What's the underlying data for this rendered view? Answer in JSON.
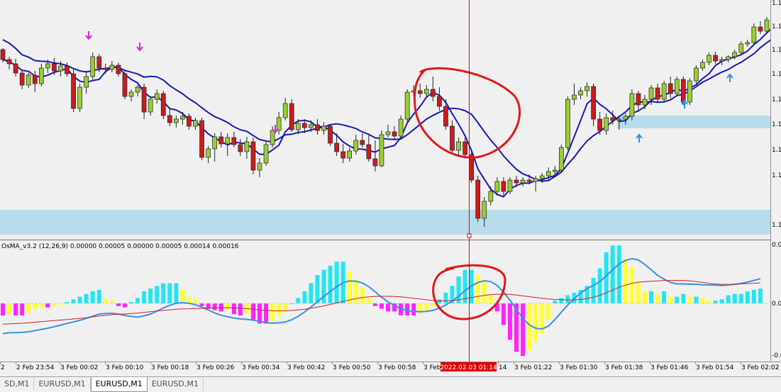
{
  "indicator_label": "OsMA_v3.2 (12,26,9) 0.00000 0.00005 0.00000 0.00005 0.00014 0.00016",
  "cursor_time_label": "2022.02.03 01:14",
  "price_tick_labels": [
    "1.1",
    "1.1",
    "1.1",
    "1.1",
    "1.1",
    "1.1",
    "1.1",
    "1.1",
    "1.1"
  ],
  "osc_tick_labels": [
    "0.0",
    "0.0",
    "-0.0"
  ],
  "time_labels": [
    "2",
    "2 Feb 23:54",
    "3 Feb 00:02",
    "3 Feb 00:10",
    "3 Feb 00:18",
    "3 Feb 00:26",
    "3 Feb 00:34",
    "3 Feb 00:42",
    "3 Feb 00:50",
    "3 Feb 00:58",
    "3 Feb",
    "14",
    "3 Feb 01:22",
    "3 Feb 01:30",
    "3 Feb 01:38",
    "3 Feb 01:46",
    "3 Feb 01:54",
    "3 Feb 02:02"
  ],
  "tabs": [
    {
      "label": "SD,M1",
      "active": false
    },
    {
      "label": "EURUSD,M1",
      "active": false
    },
    {
      "label": "EURUSD,M1",
      "active": true
    },
    {
      "label": "EURUSD,M1",
      "active": false
    }
  ],
  "colors": {
    "bull": "#9acd32",
    "bear": "#cc1b1b",
    "ma": "#1a1ab4",
    "zone": "#b8dcea",
    "cursor": "#e00000",
    "hist_up": "#22e6f0",
    "hist_down": "#ff22ff",
    "hist_fade": "#ffff33",
    "macd_line": "#3c8ee8",
    "signal_line": "#cc2020",
    "arrow_up": "#2a8ee8",
    "arrow_down": "#e020e0"
  },
  "chart_data": [
    {
      "type": "candlestick",
      "symbol": "EURUSD",
      "timeframe": "M1",
      "indicators": [
        "Moving average (fast)",
        "Moving average (slow)"
      ],
      "x_range": [
        "2 Feb 23:46",
        "3 Feb 02:05"
      ],
      "candles": [
        {
          "o": 62,
          "h": 60,
          "l": 80,
          "c": 76
        },
        {
          "o": 76,
          "h": 72,
          "l": 90,
          "c": 82
        },
        {
          "o": 82,
          "h": 75,
          "l": 100,
          "c": 95
        },
        {
          "o": 95,
          "h": 92,
          "l": 118,
          "c": 112
        },
        {
          "o": 112,
          "h": 95,
          "l": 116,
          "c": 98
        },
        {
          "o": 98,
          "h": 92,
          "l": 122,
          "c": 110
        },
        {
          "o": 110,
          "h": 82,
          "l": 114,
          "c": 88
        },
        {
          "o": 88,
          "h": 76,
          "l": 95,
          "c": 82
        },
        {
          "o": 82,
          "h": 74,
          "l": 98,
          "c": 92
        },
        {
          "o": 92,
          "h": 78,
          "l": 100,
          "c": 85
        },
        {
          "o": 85,
          "h": 80,
          "l": 100,
          "c": 96
        },
        {
          "o": 96,
          "h": 88,
          "l": 150,
          "c": 145
        },
        {
          "o": 145,
          "h": 110,
          "l": 150,
          "c": 115
        },
        {
          "o": 115,
          "h": 92,
          "l": 124,
          "c": 100
        },
        {
          "o": 100,
          "h": 66,
          "l": 104,
          "c": 72
        },
        {
          "o": 72,
          "h": 68,
          "l": 94,
          "c": 88
        },
        {
          "o": 88,
          "h": 82,
          "l": 96,
          "c": 90
        },
        {
          "o": 90,
          "h": 78,
          "l": 94,
          "c": 84
        },
        {
          "o": 84,
          "h": 80,
          "l": 100,
          "c": 96
        },
        {
          "o": 96,
          "h": 92,
          "l": 132,
          "c": 128
        },
        {
          "o": 128,
          "h": 118,
          "l": 135,
          "c": 122
        },
        {
          "o": 122,
          "h": 112,
          "l": 128,
          "c": 115
        },
        {
          "o": 115,
          "h": 110,
          "l": 160,
          "c": 150
        },
        {
          "o": 150,
          "h": 128,
          "l": 155,
          "c": 132
        },
        {
          "o": 132,
          "h": 118,
          "l": 138,
          "c": 124
        },
        {
          "o": 124,
          "h": 120,
          "l": 160,
          "c": 155
        },
        {
          "o": 155,
          "h": 146,
          "l": 170,
          "c": 165
        },
        {
          "o": 165,
          "h": 155,
          "l": 172,
          "c": 160
        },
        {
          "o": 160,
          "h": 150,
          "l": 168,
          "c": 156
        },
        {
          "o": 156,
          "h": 152,
          "l": 175,
          "c": 170
        },
        {
          "o": 170,
          "h": 158,
          "l": 175,
          "c": 162
        },
        {
          "o": 162,
          "h": 158,
          "l": 218,
          "c": 214
        },
        {
          "o": 214,
          "h": 198,
          "l": 222,
          "c": 202
        },
        {
          "o": 202,
          "h": 180,
          "l": 220,
          "c": 185
        },
        {
          "o": 185,
          "h": 178,
          "l": 200,
          "c": 195
        },
        {
          "o": 195,
          "h": 180,
          "l": 212,
          "c": 186
        },
        {
          "o": 186,
          "h": 178,
          "l": 200,
          "c": 196
        },
        {
          "o": 196,
          "h": 188,
          "l": 212,
          "c": 206
        },
        {
          "o": 206,
          "h": 185,
          "l": 216,
          "c": 192
        },
        {
          "o": 192,
          "h": 186,
          "l": 238,
          "c": 232
        },
        {
          "o": 232,
          "h": 215,
          "l": 242,
          "c": 222
        },
        {
          "o": 222,
          "h": 190,
          "l": 226,
          "c": 196
        },
        {
          "o": 196,
          "h": 170,
          "l": 200,
          "c": 176
        },
        {
          "o": 176,
          "h": 150,
          "l": 182,
          "c": 158
        },
        {
          "o": 158,
          "h": 130,
          "l": 162,
          "c": 138
        },
        {
          "o": 138,
          "h": 132,
          "l": 178,
          "c": 175
        },
        {
          "o": 175,
          "h": 160,
          "l": 182,
          "c": 166
        },
        {
          "o": 166,
          "h": 160,
          "l": 180,
          "c": 172
        },
        {
          "o": 172,
          "h": 162,
          "l": 178,
          "c": 168
        },
        {
          "o": 168,
          "h": 160,
          "l": 182,
          "c": 176
        },
        {
          "o": 176,
          "h": 164,
          "l": 182,
          "c": 170
        },
        {
          "o": 170,
          "h": 168,
          "l": 198,
          "c": 194
        },
        {
          "o": 194,
          "h": 180,
          "l": 212,
          "c": 206
        },
        {
          "o": 206,
          "h": 195,
          "l": 222,
          "c": 215
        },
        {
          "o": 215,
          "h": 200,
          "l": 220,
          "c": 205
        },
        {
          "o": 205,
          "h": 182,
          "l": 210,
          "c": 190
        },
        {
          "o": 190,
          "h": 180,
          "l": 200,
          "c": 196
        },
        {
          "o": 196,
          "h": 182,
          "l": 220,
          "c": 216
        },
        {
          "o": 216,
          "h": 190,
          "l": 234,
          "c": 226
        },
        {
          "o": 226,
          "h": 176,
          "l": 228,
          "c": 182
        },
        {
          "o": 182,
          "h": 168,
          "l": 186,
          "c": 178
        },
        {
          "o": 178,
          "h": 170,
          "l": 190,
          "c": 184
        },
        {
          "o": 184,
          "h": 155,
          "l": 188,
          "c": 160
        },
        {
          "o": 160,
          "h": 118,
          "l": 164,
          "c": 122
        },
        {
          "o": 122,
          "h": 112,
          "l": 128,
          "c": 120
        },
        {
          "o": 120,
          "h": 110,
          "l": 130,
          "c": 124
        },
        {
          "o": 124,
          "h": 112,
          "l": 128,
          "c": 118
        },
        {
          "o": 118,
          "h": 100,
          "l": 135,
          "c": 128
        },
        {
          "o": 128,
          "h": 115,
          "l": 148,
          "c": 142
        },
        {
          "o": 142,
          "h": 132,
          "l": 175,
          "c": 170
        },
        {
          "o": 170,
          "h": 162,
          "l": 210,
          "c": 204
        },
        {
          "o": 204,
          "h": 186,
          "l": 212,
          "c": 192
        },
        {
          "o": 192,
          "h": 186,
          "l": 216,
          "c": 210
        },
        {
          "o": 210,
          "h": 205,
          "l": 250,
          "c": 246
        },
        {
          "o": 246,
          "h": 240,
          "l": 305,
          "c": 300
        },
        {
          "o": 300,
          "h": 270,
          "l": 312,
          "c": 276
        },
        {
          "o": 276,
          "h": 255,
          "l": 282,
          "c": 262
        },
        {
          "o": 262,
          "h": 242,
          "l": 268,
          "c": 248
        },
        {
          "o": 248,
          "h": 242,
          "l": 270,
          "c": 262
        },
        {
          "o": 262,
          "h": 242,
          "l": 266,
          "c": 246
        },
        {
          "o": 246,
          "h": 240,
          "l": 256,
          "c": 250
        },
        {
          "o": 250,
          "h": 242,
          "l": 255,
          "c": 246
        },
        {
          "o": 246,
          "h": 238,
          "l": 252,
          "c": 248
        },
        {
          "o": 248,
          "h": 240,
          "l": 262,
          "c": 244
        },
        {
          "o": 244,
          "h": 236,
          "l": 250,
          "c": 240
        },
        {
          "o": 240,
          "h": 228,
          "l": 248,
          "c": 234
        },
        {
          "o": 234,
          "h": 226,
          "l": 240,
          "c": 232
        },
        {
          "o": 232,
          "h": 196,
          "l": 236,
          "c": 200
        },
        {
          "o": 200,
          "h": 128,
          "l": 204,
          "c": 132
        },
        {
          "o": 132,
          "h": 110,
          "l": 140,
          "c": 126
        },
        {
          "o": 126,
          "h": 115,
          "l": 132,
          "c": 120
        },
        {
          "o": 120,
          "h": 108,
          "l": 128,
          "c": 114
        },
        {
          "o": 114,
          "h": 110,
          "l": 170,
          "c": 160
        },
        {
          "o": 160,
          "h": 150,
          "l": 182,
          "c": 176
        },
        {
          "o": 176,
          "h": 152,
          "l": 182,
          "c": 158
        },
        {
          "o": 158,
          "h": 148,
          "l": 168,
          "c": 162
        },
        {
          "o": 162,
          "h": 155,
          "l": 175,
          "c": 160
        },
        {
          "o": 160,
          "h": 152,
          "l": 168,
          "c": 156
        },
        {
          "o": 156,
          "h": 118,
          "l": 162,
          "c": 124
        },
        {
          "o": 124,
          "h": 120,
          "l": 150,
          "c": 140
        },
        {
          "o": 140,
          "h": 126,
          "l": 146,
          "c": 132
        },
        {
          "o": 132,
          "h": 112,
          "l": 140,
          "c": 116
        },
        {
          "o": 116,
          "h": 110,
          "l": 136,
          "c": 132
        },
        {
          "o": 132,
          "h": 106,
          "l": 136,
          "c": 110
        },
        {
          "o": 110,
          "h": 100,
          "l": 130,
          "c": 124
        },
        {
          "o": 124,
          "h": 100,
          "l": 128,
          "c": 104
        },
        {
          "o": 104,
          "h": 100,
          "l": 140,
          "c": 136
        },
        {
          "o": 136,
          "h": 102,
          "l": 140,
          "c": 106
        },
        {
          "o": 106,
          "h": 84,
          "l": 110,
          "c": 88
        },
        {
          "o": 88,
          "h": 76,
          "l": 92,
          "c": 80
        },
        {
          "o": 80,
          "h": 66,
          "l": 84,
          "c": 70
        },
        {
          "o": 70,
          "h": 65,
          "l": 82,
          "c": 78
        },
        {
          "o": 78,
          "h": 72,
          "l": 84,
          "c": 76
        },
        {
          "o": 76,
          "h": 70,
          "l": 80,
          "c": 72
        },
        {
          "o": 72,
          "h": 62,
          "l": 76,
          "c": 66
        },
        {
          "o": 66,
          "h": 50,
          "l": 70,
          "c": 54
        },
        {
          "o": 54,
          "h": 48,
          "l": 58,
          "c": 52
        },
        {
          "o": 52,
          "h": 25,
          "l": 56,
          "c": 30
        },
        {
          "o": 30,
          "h": 22,
          "l": 40,
          "c": 36
        },
        {
          "o": 36,
          "h": 16,
          "l": 40,
          "c": 20
        },
        {
          "o": 20,
          "h": 10,
          "l": 26,
          "c": 14
        },
        {
          "o": 14,
          "h": 0,
          "l": 18,
          "c": 4
        }
      ],
      "zones": [
        {
          "label": "support zone",
          "from": 296,
          "to": 331
        },
        {
          "label": "resistance zone",
          "from": 163,
          "to": 181
        }
      ],
      "signal_arrows": [
        {
          "dir": "down",
          "at": "3 Feb 00:05"
        },
        {
          "dir": "down",
          "at": "3 Feb 00:15"
        },
        {
          "dir": "down",
          "at": "3 Feb 00:38"
        },
        {
          "dir": "up",
          "at": "3 Feb 01:42"
        },
        {
          "dir": "up",
          "at": "3 Feb 01:50"
        },
        {
          "dir": "up",
          "at": "3 Feb 02:01"
        }
      ]
    },
    {
      "type": "bar",
      "name": "OsMA_v3.2 (12,26,9)",
      "values": [
        -0.9,
        -0.8,
        -0.9,
        -0.9,
        -0.7,
        -0.4,
        -0.3,
        -0.3,
        -0.2,
        -0.1,
        0.1,
        0.3,
        0.5,
        0.7,
        0.9,
        1.0,
        0.3,
        0.2,
        -0.2,
        -0.3,
        0.1,
        0.4,
        0.9,
        1.1,
        1.3,
        1.5,
        1.5,
        1.5,
        1.0,
        0.5,
        0.3,
        -0.2,
        -0.4,
        -0.5,
        -0.6,
        -0.5,
        -0.8,
        -0.9,
        -0.8,
        -1.2,
        -1.5,
        -1.5,
        -1.3,
        -0.9,
        -0.5,
        0.0,
        0.4,
        0.9,
        1.5,
        2.1,
        2.5,
        2.8,
        3.1,
        3.1,
        2.4,
        1.8,
        1.2,
        0.4,
        -0.2,
        -0.4,
        -0.6,
        -0.6,
        -0.9,
        -0.9,
        -0.9,
        -0.8,
        -0.6,
        -0.2,
        0.3,
        0.8,
        1.3,
        2.0,
        2.5,
        2.5,
        2.1,
        1.7,
        0.6,
        -0.6,
        -1.6,
        -2.7,
        -3.6,
        -3.9,
        -3.5,
        -2.9,
        -2.2,
        -1.2,
        0.2,
        0.4,
        0.6,
        0.8,
        1.0,
        1.3,
        1.9,
        2.6,
        3.8,
        4.3,
        4.3,
        3.3,
        2.7,
        1.6,
        0.9,
        0.9,
        0.7,
        0.9,
        0.5,
        0.5,
        0.7,
        0.5,
        0.5,
        0.4,
        0.2,
        0.2,
        0.3,
        0.6,
        0.7,
        0.7,
        0.9,
        1.0,
        1.1
      ],
      "ylim": [
        -4.2,
        4.6
      ]
    }
  ]
}
